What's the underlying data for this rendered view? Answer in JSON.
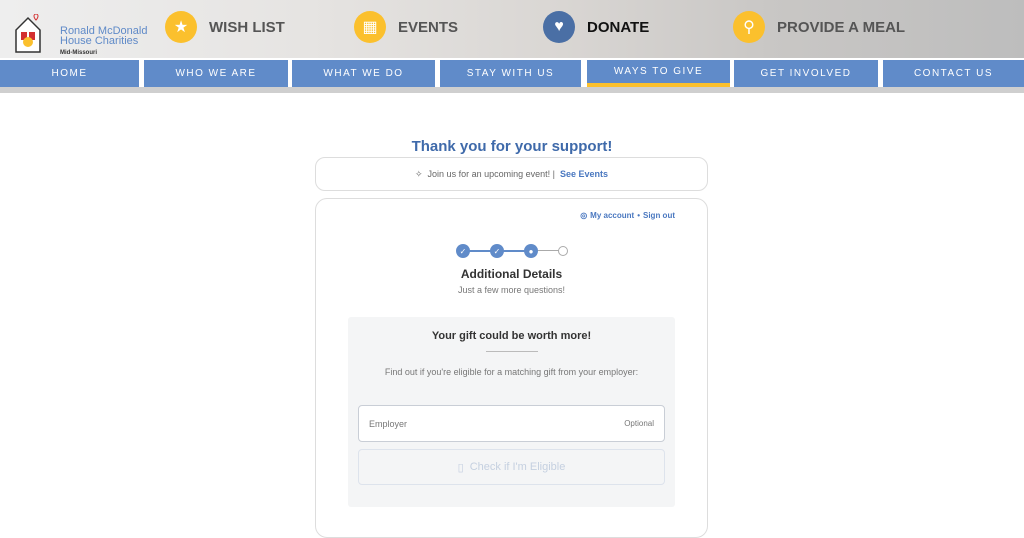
{
  "header": {
    "logo": {
      "line1": "Ronald McDonald",
      "line2": "House Charities",
      "line3": "Mid-Missouri"
    },
    "quick_links": [
      {
        "label": "WISH LIST",
        "icon": "star-icon"
      },
      {
        "label": "EVENTS",
        "icon": "calendar-icon"
      },
      {
        "label": "DONATE",
        "icon": "heart-icon"
      },
      {
        "label": "PROVIDE A MEAL",
        "icon": "spoon-icon"
      }
    ]
  },
  "nav": {
    "items": [
      "HOME",
      "WHO WE ARE",
      "WHAT WE DO",
      "STAY WITH US",
      "WAYS TO GIVE",
      "GET INVOLVED",
      "CONTACT US"
    ],
    "active": "WAYS TO GIVE"
  },
  "main": {
    "title": "Thank you for your support!",
    "banner": {
      "text": "Join us for an upcoming event! |",
      "link": "See Events"
    },
    "account": {
      "my_account": "My account",
      "separator": "•",
      "sign_out": "Sign out"
    },
    "steps": {
      "total": 4,
      "completed": 2,
      "current": 3
    },
    "heading": "Additional Details",
    "subheading": "Just a few more questions!",
    "gift": {
      "title": "Your gift could be worth more!",
      "description": "Find out if you're eligible for a matching gift from your employer:",
      "employer_placeholder": "Employer",
      "optional": "Optional",
      "check_button": "Check if I'm Eligible"
    }
  },
  "colors": {
    "brand_blue": "#608bc9",
    "accent_yellow": "#fbc02d",
    "title_blue": "#3f6aaa"
  }
}
